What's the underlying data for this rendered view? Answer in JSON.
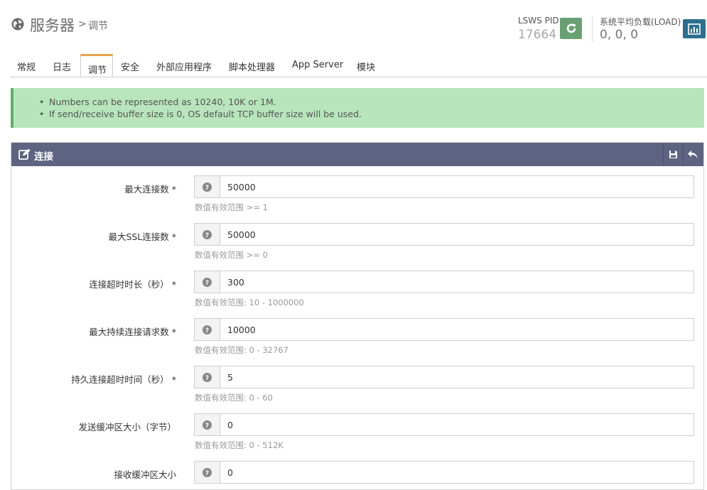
{
  "header": {
    "title": "服务器",
    "separator": ">",
    "subtitle": "调节",
    "pid_label": "LSWS PID",
    "pid_value": "17664",
    "load_label": "系统平均负载(LOAD)",
    "load_value": "0, 0, 0"
  },
  "tabs": [
    {
      "label": "常规"
    },
    {
      "label": "日志"
    },
    {
      "label": "调节"
    },
    {
      "label": "安全"
    },
    {
      "label": "外部应用程序"
    },
    {
      "label": "脚本处理器"
    },
    {
      "label": "App Server"
    },
    {
      "label": "模块"
    }
  ],
  "info": {
    "items": [
      "Numbers can be represented as 10240, 10K or 1M.",
      "If send/receive buffer size is 0, OS default TCP buffer size will be used."
    ]
  },
  "panel": {
    "title": "连接",
    "rows": [
      {
        "label": "最大连接数 *",
        "value": "50000",
        "hint": "数值有效范围 >= 1"
      },
      {
        "label": "最大SSL连接数 *",
        "value": "50000",
        "hint": "数值有效范围 >= 0"
      },
      {
        "label": "连接超时时长（秒） *",
        "value": "300",
        "hint": "数值有效范围: 10 - 1000000"
      },
      {
        "label": "最大持续连接请求数 *",
        "value": "10000",
        "hint": "数值有效范围: 0 - 32767"
      },
      {
        "label": "持久连接超时时间（秒） *",
        "value": "5",
        "hint": "数值有效范围: 0 - 60"
      },
      {
        "label": "发送缓冲区大小（字节）",
        "value": "0",
        "hint": "数值有效范围: 0 - 512K"
      },
      {
        "label": "接收缓冲区大小",
        "value": "0",
        "hint": ""
      }
    ]
  },
  "colors": {
    "accent_tab": "#e8a24a",
    "panel_header": "#5f6382",
    "info_bg": "#b8e5bc",
    "pid_button": "#6a9f73",
    "load_button": "#2b6f8c"
  }
}
